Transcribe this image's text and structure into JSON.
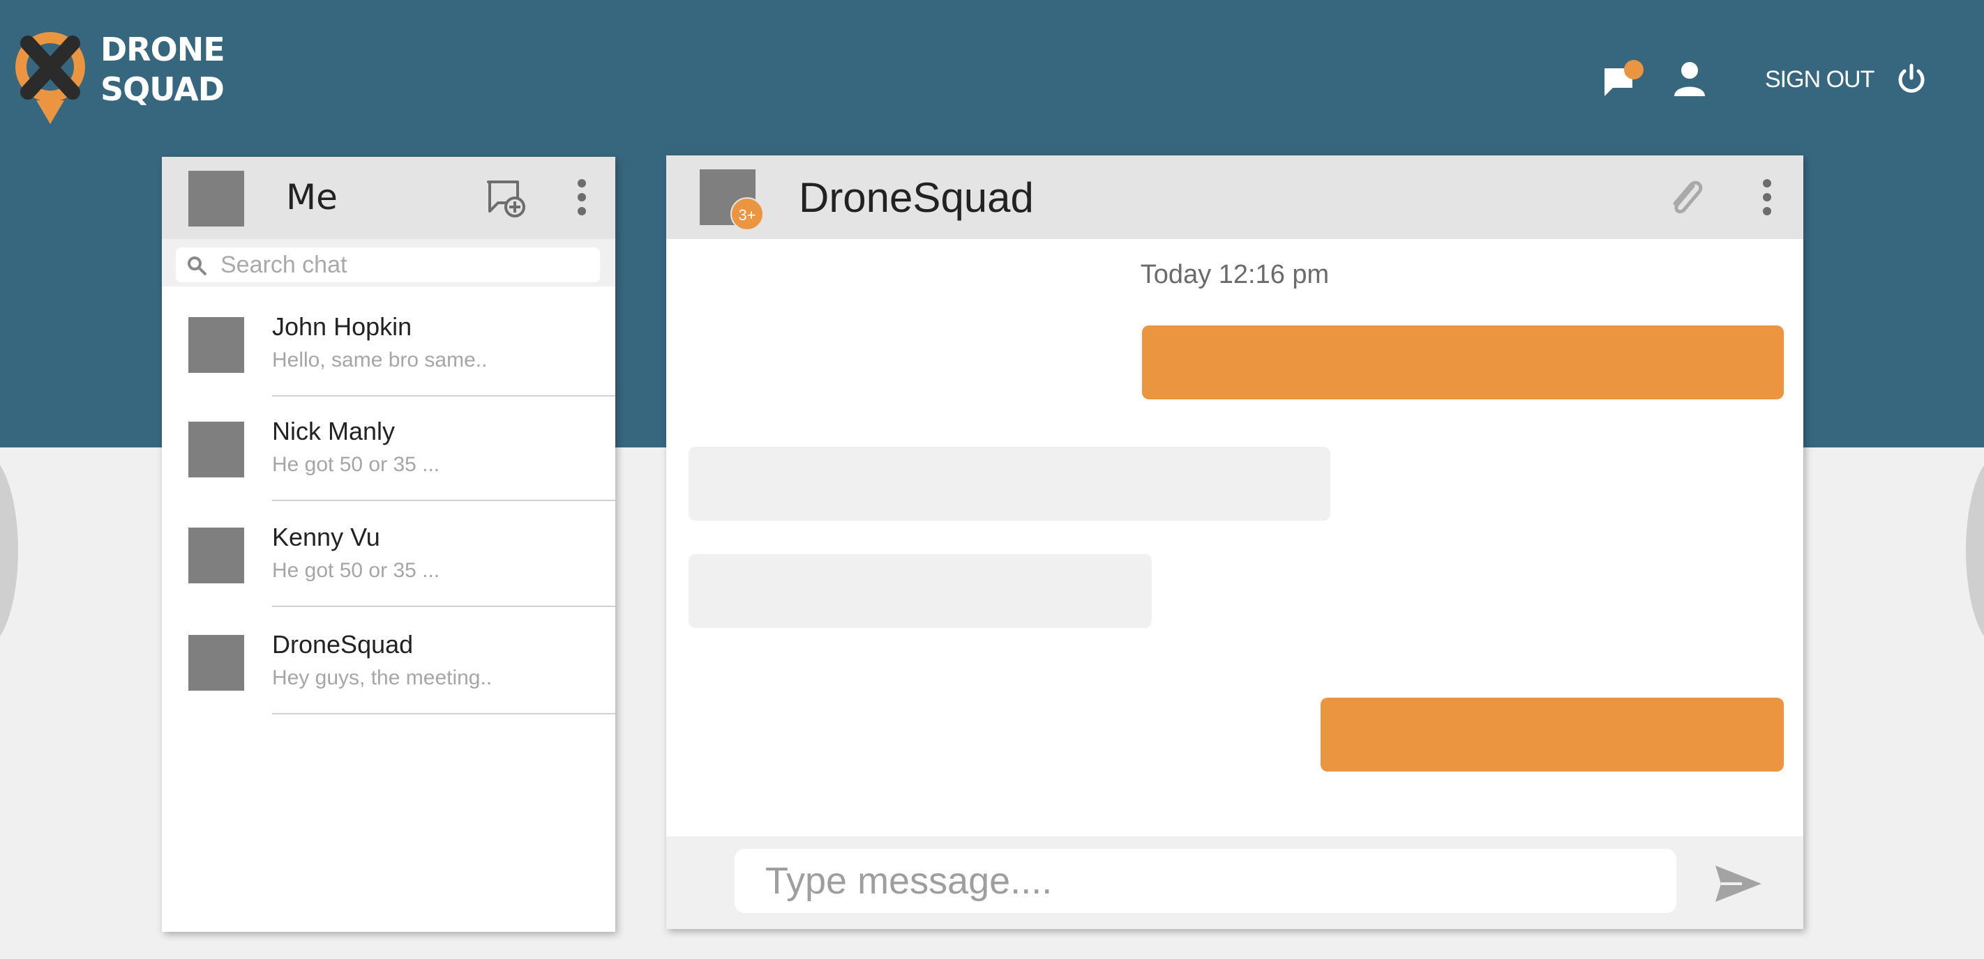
{
  "app": {
    "brand_line1": "DRONE",
    "brand_line2": "SQUAD"
  },
  "colors": {
    "header_bg": "#37677f",
    "accent": "#eb9540",
    "page_bg": "#f0f0f0",
    "avatar_placeholder": "#7f7f7f"
  },
  "nav": {
    "chat_icon": "chat-bubble-icon",
    "notification": "notification-dot",
    "user_icon": "user-icon",
    "signout_label": "SIGN OUT",
    "power_icon": "power-icon"
  },
  "sidebar": {
    "title": "Me",
    "new_chat_icon": "new-chat-icon",
    "menu_icon": "more-vertical-icon",
    "search": {
      "placeholder": "Search chat",
      "value": ""
    },
    "chats": [
      {
        "name": "John Hopkin",
        "preview": "Hello, same bro same.."
      },
      {
        "name": "Nick Manly",
        "preview": "He got 50 or 35 ..."
      },
      {
        "name": "Kenny Vu",
        "preview": "He got 50 or 35 ..."
      },
      {
        "name": "DroneSquad",
        "preview": "Hey guys, the meeting.."
      }
    ]
  },
  "conversation": {
    "title": "DroneSquad",
    "member_badge": "3+",
    "attach_icon": "paperclip-icon",
    "menu_icon": "more-vertical-icon",
    "timestamp": "Today 12:16 pm",
    "messages": [
      {
        "direction": "outgoing",
        "text": ""
      },
      {
        "direction": "incoming",
        "text": ""
      },
      {
        "direction": "incoming",
        "text": ""
      },
      {
        "direction": "outgoing",
        "text": ""
      }
    ],
    "composer": {
      "placeholder": "Type message....",
      "value": "",
      "send_icon": "send-icon"
    }
  }
}
